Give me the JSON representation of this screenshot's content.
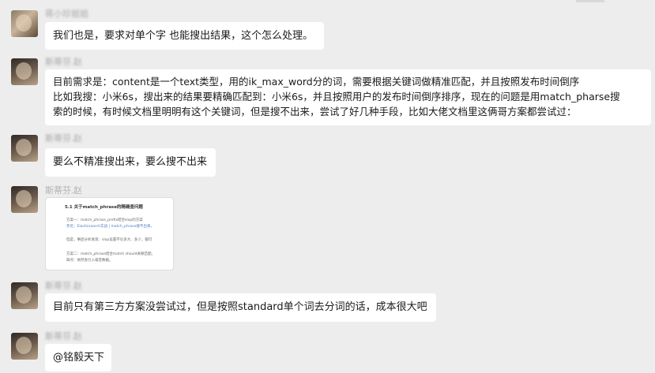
{
  "messages": [
    {
      "sender": "蒋小珍姐姐",
      "lines": [
        "我们也是，要求对单个字 也能搜出结果，这个怎么处理。"
      ]
    },
    {
      "sender": "斯蒂芬.赵",
      "lines": [
        "目前需求是：content是一个text类型，用的ik_max_word分的词，需要根据关键词做精准匹配，并且按照发布时间倒序",
        "比如我搜：小米6s，搜出来的结果要精确匹配到：小米6s，并且按照用户的发布时间倒序排序，现在的问题是用match_pharse搜",
        "索的时候，有时候文档里明明有这个关键词，但是搜不出来，尝试了好几种手段，比如大佬文档里这俩哥方案都尝试过："
      ]
    },
    {
      "sender": "斯蒂芬.赵",
      "lines": [
        "要么不精准搜出来，要么搜不出来"
      ]
    },
    {
      "sender": "斯蒂芬.赵",
      "image": {
        "title": "5.1 关于match_phrase的精确查问题",
        "rows": [
          "方案一：match_phrase_prefix结合slop的方案",
          "参见：Elasticsearch实战 | match_phrase搜不出来，",
          "但是，事后分析发现：slop设置不论多大、多少，都可",
          "方案二：match_phrase结合match should关联匹配。",
          "缺点：依然会引入噪音数据。"
        ]
      }
    },
    {
      "sender": "斯蒂芬.赵",
      "lines": [
        "目前只有第三方方案没尝试过，但是按照standard单个词去分词的话，成本很大吧"
      ]
    },
    {
      "sender": "斯蒂芬.赵",
      "lines": [
        "@铭毅天下"
      ]
    }
  ]
}
